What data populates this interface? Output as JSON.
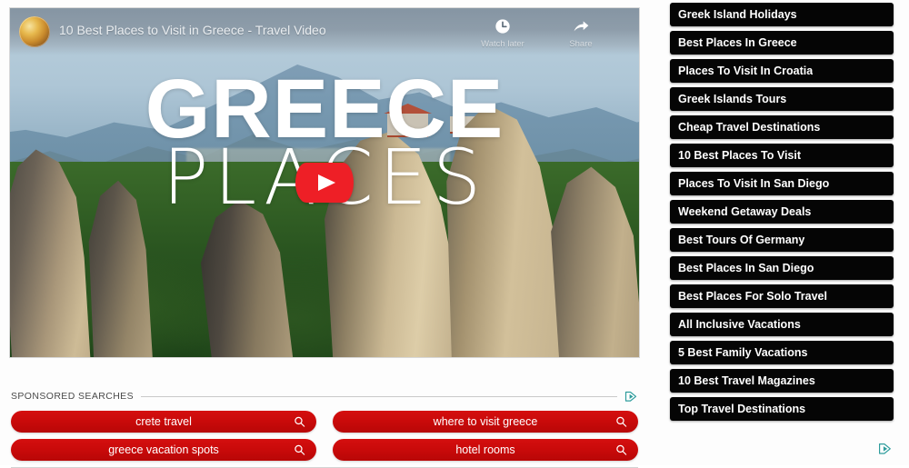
{
  "video": {
    "title": "10 Best Places to Visit in Greece - Travel Video",
    "avatar_icon": "channel-avatar-thumbnail",
    "overlay_line1": "GREECE",
    "overlay_line2": "PLACES",
    "play_icon": "youtube-play-icon",
    "actions": [
      {
        "label": "Watch later",
        "icon": "clock-icon"
      },
      {
        "label": "Share",
        "icon": "share-arrow-icon"
      }
    ]
  },
  "sponsored": {
    "heading": "SPONSORED SEARCHES",
    "adchoices_icon": "adchoices-icon",
    "search_icon": "magnifier-icon",
    "items": [
      "crete travel",
      "where to visit greece",
      "greece vacation spots",
      "hotel rooms"
    ]
  },
  "sidebar": {
    "adchoices_icon": "adchoices-icon",
    "items": [
      "Greek Island Holidays",
      "Best Places In Greece",
      "Places To Visit In Croatia",
      "Greek Islands Tours",
      "Cheap Travel Destinations",
      "10 Best Places To Visit",
      "Places To Visit In San Diego",
      "Weekend Getaway Deals",
      "Best Tours Of Germany",
      "Best Places In San Diego",
      "Best Places For Solo Travel",
      "All Inclusive Vacations",
      "5 Best Family Vacations",
      "10 Best Travel Magazines",
      "Top Travel Destinations"
    ]
  },
  "colors": {
    "ad_red": "#c90a0a",
    "sidebar_black": "#050505",
    "play_red": "#ee1f26",
    "adchoices_teal": "#2f9d9d",
    "page_background": "#fdfdfd"
  }
}
